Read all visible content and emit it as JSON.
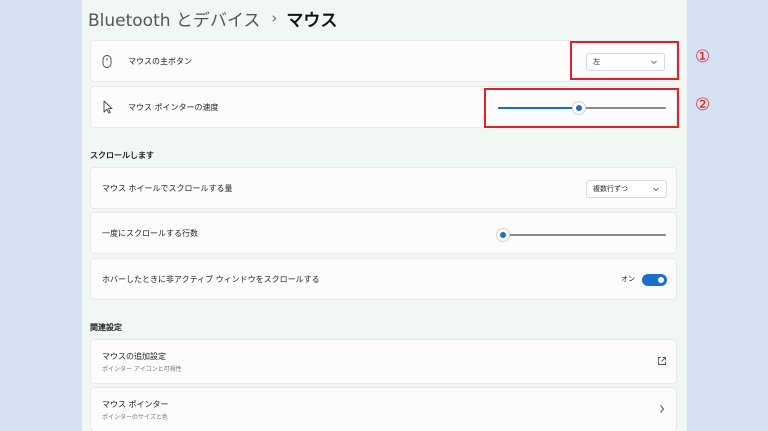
{
  "breadcrumb": {
    "parent": "Bluetooth とデバイス",
    "separator": "›",
    "current": "マウス"
  },
  "primary_button": {
    "label": "マウスの主ボタン",
    "value": "左"
  },
  "pointer_speed": {
    "label": "マウス ポインターの速度",
    "value_fraction": 0.48
  },
  "scroll_section": {
    "title": "スクロールします"
  },
  "wheel_scroll": {
    "label": "マウス ホイールでスクロールする量",
    "value": "複数行ずつ"
  },
  "lines_to_scroll": {
    "label": "一度にスクロールする行数",
    "value_fraction": 0.03
  },
  "inactive_scroll": {
    "label": "ホバーしたときに非アクティブ ウィンドウをスクロールする",
    "state": "オン"
  },
  "related_section": {
    "title": "関連設定"
  },
  "additional_settings": {
    "title": "マウスの追加設定",
    "subtitle": "ポインター アイコンと可視性"
  },
  "mouse_pointer": {
    "title": "マウス ポインター",
    "subtitle": "ポインターのサイズと色"
  },
  "annotations": {
    "one": "①",
    "two": "②"
  },
  "colors": {
    "accent": "#1a6fc8",
    "annotation": "#e0202a"
  }
}
